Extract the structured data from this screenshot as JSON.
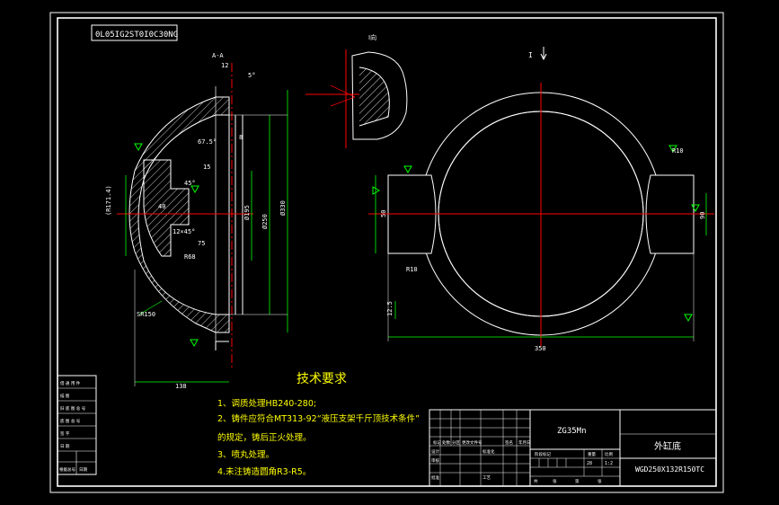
{
  "drawing": {
    "code_box": "0L05IG2ST0I0C30NG",
    "section_label": "A-A",
    "detail_label": "I向",
    "arrow_label": "I",
    "tech_title": "技术要求",
    "requirements": [
      "1、调质处理HB240-280;",
      "2、铸件应符合MT313-92“液压支架千斤顶技术条件”",
      "的规定，铸后正火处理。",
      "3、喷丸处理。",
      "4.未注铸造圆角R3-R5。"
    ],
    "material": "ZG35Mn",
    "part_name": "外缸底",
    "part_code": "WGD250X132R150TC",
    "dims": {
      "d_ext": "350",
      "r_top": "R10",
      "r_left": "R10",
      "d_left": "50",
      "d_right": "90",
      "d_bottom": "12.5",
      "sect_d1": "Ø250",
      "sect_d2": "Ø330",
      "sect_d3": "Ø195",
      "sect_h": "(R171.4)",
      "sect_w": "138",
      "sect_r": "SR150",
      "sect_ch": "12×45°",
      "sect_a": "45°",
      "sect_15": "15",
      "sect_75": "75",
      "sect_12": "12",
      "sect_40": "40",
      "sect_5": "5°",
      "sect_ang": "67.5°",
      "sect_r68": "R68",
      "sect_8": "8"
    },
    "left_block_labels": [
      "借 通 用 件",
      "描 图",
      "旧 底 图 总 号",
      "底 图 总 号",
      "签 字",
      "日 期",
      "根据总号",
      "日期"
    ],
    "title_small_labels": [
      "标记",
      "处数",
      "分区",
      "更改文件号",
      "签名",
      "年月日",
      "设计",
      "标准化",
      "审核",
      "工艺",
      "批准",
      "阶段标记",
      "重量",
      "比例",
      "共",
      "张",
      "第",
      "张"
    ],
    "scale": "1:2",
    "weight": "28"
  }
}
